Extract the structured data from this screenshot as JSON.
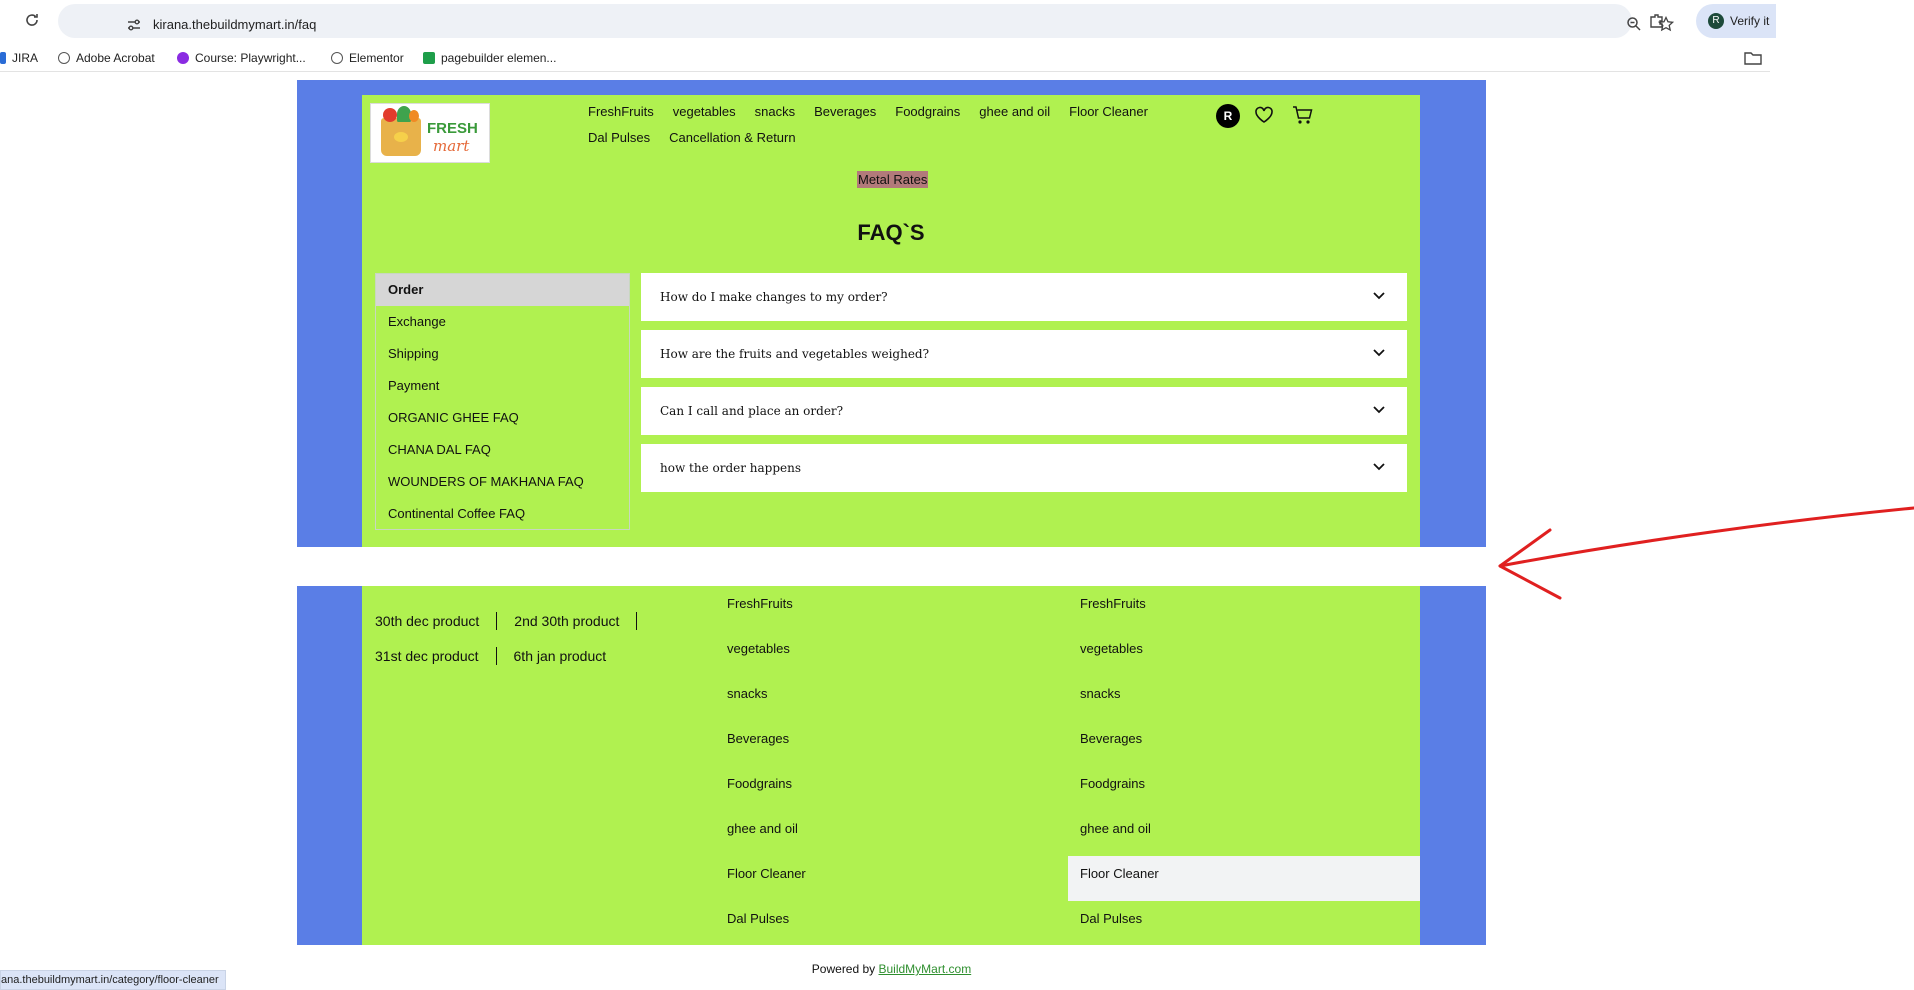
{
  "browser": {
    "url": "kirana.thebuildmymart.in/faq",
    "profile_label": "Verify it",
    "profile_initial": "R",
    "bookmarks": [
      "JIRA",
      "Adobe Acrobat",
      "Course: Playwright...",
      "Elementor",
      "pagebuilder elemen..."
    ],
    "status_url": "ana.thebuildmymart.in/category/floor-cleaner"
  },
  "header": {
    "logo_line1": "FRESH",
    "logo_line2": "mart",
    "nav_row1": [
      "FreshFruits",
      "vegetables",
      "snacks",
      "Beverages",
      "Foodgrains",
      "ghee and oil",
      "Floor Cleaner"
    ],
    "nav_row2": [
      "Dal Pulses",
      "Cancellation & Return"
    ],
    "user_initial": "R",
    "metal_rates": "Metal Rates"
  },
  "faq": {
    "title": "FAQ`S",
    "categories": [
      "Order",
      "Exchange",
      "Shipping",
      "Payment",
      "ORGANIC GHEE FAQ",
      "CHANA DAL FAQ",
      "WOUNDERS OF MAKHANA FAQ",
      "Continental Coffee FAQ"
    ],
    "active_category": "Order",
    "questions": [
      "How do I make changes to my order?",
      "How are the fruits and vegetables weighed?",
      "Can I call and place an order?",
      "how the order happens"
    ]
  },
  "footer": {
    "products_row1": [
      "30th dec product",
      "2nd 30th product"
    ],
    "products_row2": [
      "31st dec product",
      "6th jan product"
    ],
    "col_a": [
      "FreshFruits",
      "vegetables",
      "snacks",
      "Beverages",
      "Foodgrains",
      "ghee and oil",
      "Floor Cleaner",
      "Dal Pulses"
    ],
    "col_b": [
      "FreshFruits",
      "vegetables",
      "snacks",
      "Beverages",
      "Foodgrains",
      "ghee and oil",
      "Floor Cleaner",
      "Dal Pulses"
    ],
    "col_b_highlight": "Floor Cleaner",
    "powered_prefix": "Powered by ",
    "powered_link": "BuildMyMart.com"
  },
  "colors": {
    "frame_blue": "#5a7ee6",
    "page_green": "#b0f150",
    "annotation_red": "#e02020"
  }
}
